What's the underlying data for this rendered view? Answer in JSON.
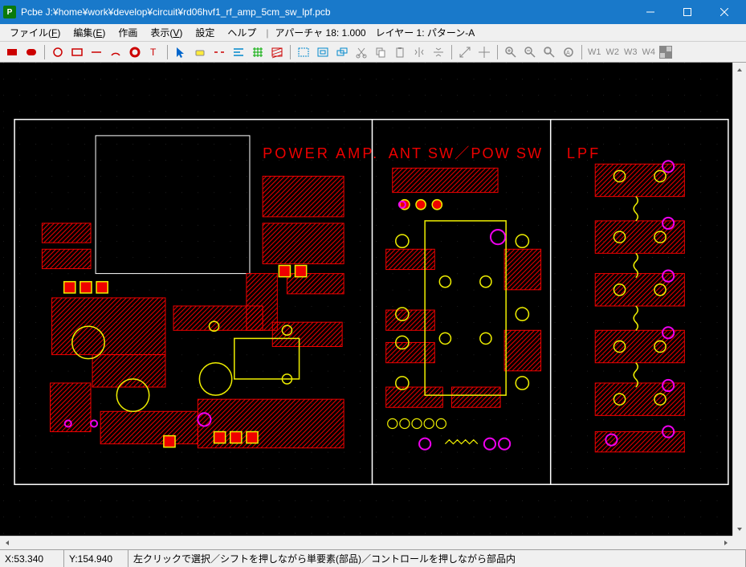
{
  "titlebar": {
    "app_icon_letter": "P",
    "title": "Pcbe J:¥home¥work¥develop¥circuit¥rd06hvf1_rf_amp_5cm_sw_lpf.pcb"
  },
  "menubar": {
    "items": [
      {
        "label": "ファイル(F)",
        "u": "F"
      },
      {
        "label": "編集(E)",
        "u": "E"
      },
      {
        "label": "作画",
        "u": ""
      },
      {
        "label": "表示(V)",
        "u": "V"
      },
      {
        "label": "設定",
        "u": ""
      },
      {
        "label": "ヘルプ",
        "u": ""
      }
    ],
    "aperture": "アパーチャ 18: 1.000",
    "layer": "レイヤー 1: パターン-A"
  },
  "toolbar": {
    "layer_labels": [
      "W1",
      "W2",
      "W3",
      "W4"
    ]
  },
  "canvas": {
    "labels": {
      "power_amp": "POWER  AMP.",
      "ant_sw": "ANT  SW／POW  SW",
      "lpf": "LPF"
    },
    "colors": {
      "trace": "#ee0000",
      "silk": "#eeee00",
      "pad_ring": "#ee00ee",
      "text": "#ee0000",
      "outline": "#ffffff",
      "grid": "#666666"
    }
  },
  "statusbar": {
    "x": "X:53.340",
    "y": "Y:154.940",
    "msg": "左クリックで選択／シフトを押しながら単要素(部品)／コントロールを押しながら部品内"
  }
}
